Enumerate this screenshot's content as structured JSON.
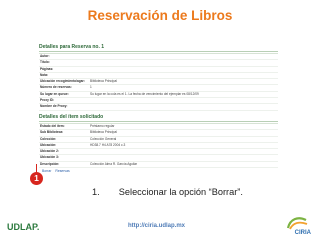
{
  "slide": {
    "title": "Reservación de Libros",
    "step_marker": "1",
    "instruction_number": "1.",
    "instruction_text": "Seleccionar la opción “Borrar”."
  },
  "screenshot": {
    "section1_title": "Detalles para Reserva no. 1",
    "section1_rows": [
      {
        "label": "Autor:",
        "value": ""
      },
      {
        "label": "Título:",
        "value": ""
      },
      {
        "label": "Páginas:",
        "value": ""
      },
      {
        "label": "Nota:",
        "value": ""
      },
      {
        "label": "Ubicación recogimiento/agar:",
        "value": "Biblioteca Principal"
      },
      {
        "label": "Número de reservas:",
        "value": "1"
      },
      {
        "label": "Su lugar en queue:",
        "value": "Su lugar en la cola es el 1. La fecha de vencimiento del ejemplar es 08/12/09"
      },
      {
        "label": "Proxy ID:",
        "value": ""
      },
      {
        "label": "Nombre de Proxy:",
        "value": ""
      }
    ],
    "section2_title": "Detalles del ítem solicitado",
    "section2_rows": [
      {
        "label": "Estado del ítem:",
        "value": "Préstamo regular"
      },
      {
        "label": "Sub Biblioteca:",
        "value": "Biblioteca Principal"
      },
      {
        "label": "Colección:",
        "value": "Colección General"
      },
      {
        "label": "Ubicación:",
        "value": "HD38.7 H4 A78 2004 c.3"
      },
      {
        "label": "Ubicación 2:",
        "value": ""
      },
      {
        "label": "Ubicación 3:",
        "value": ""
      },
      {
        "label": "Descripción:",
        "value": "Colección Alma R. García Aguilar"
      }
    ],
    "links": [
      "Borrar",
      "Reservas"
    ]
  },
  "footer": {
    "left_logo": "UDLAP.",
    "url": "http://ciria.udlap.mx",
    "right_logo": "CIRIA"
  },
  "colors": {
    "title": "#ec7a1d",
    "marker": "#d7261e",
    "udlap_green": "#2c7a3e",
    "url_blue": "#4f7cb7"
  }
}
